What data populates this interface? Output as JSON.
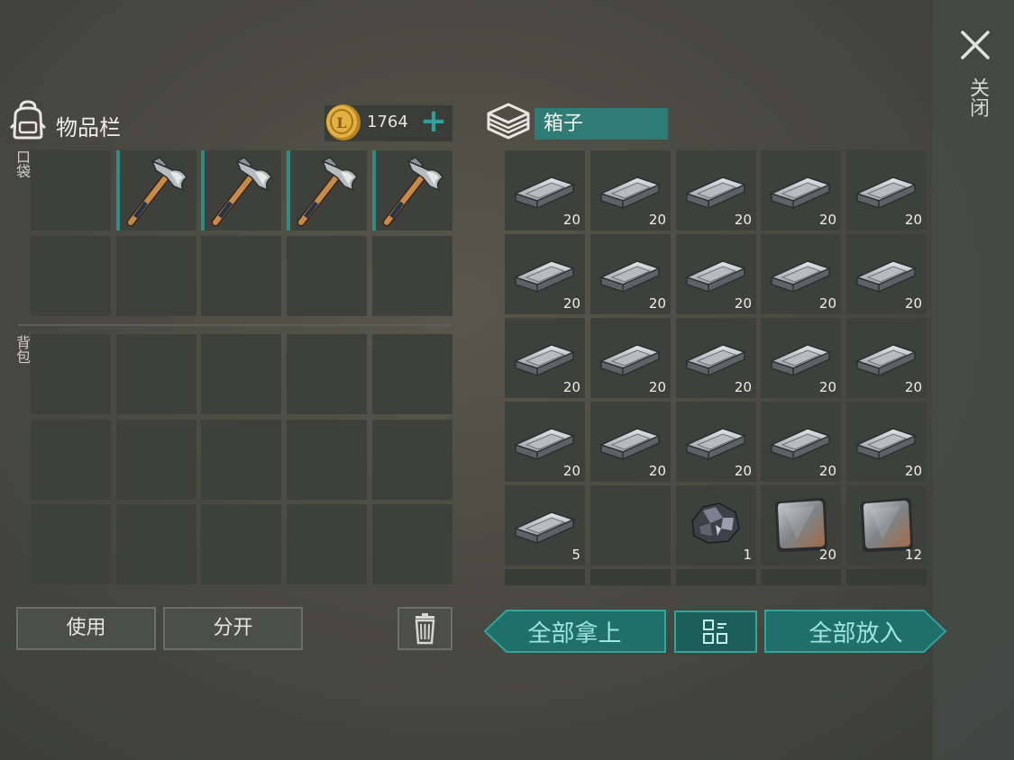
{
  "header": {
    "close_label": "关闭",
    "close_icon": "close-icon"
  },
  "inventory": {
    "title": "物品栏",
    "icon": "backpack-icon",
    "coins": "1764",
    "pocket_label": "口袋",
    "backpack_label": "背包",
    "pocket_slots": [
      {
        "item": "",
        "count": ""
      },
      {
        "item": "hatchet",
        "count": ""
      },
      {
        "item": "hatchet",
        "count": ""
      },
      {
        "item": "hatchet",
        "count": ""
      },
      {
        "item": "hatchet",
        "count": ""
      },
      {
        "item": "",
        "count": ""
      },
      {
        "item": "",
        "count": ""
      },
      {
        "item": "",
        "count": ""
      },
      {
        "item": "",
        "count": ""
      },
      {
        "item": "",
        "count": ""
      }
    ],
    "buttons": {
      "use": "使用",
      "split": "分开",
      "trash_icon": "trash-icon"
    }
  },
  "chest": {
    "title": "箱子",
    "icon": "chest-icon",
    "slots": [
      {
        "item": "iron-ingot",
        "count": "20"
      },
      {
        "item": "iron-ingot",
        "count": "20"
      },
      {
        "item": "iron-ingot",
        "count": "20"
      },
      {
        "item": "iron-ingot",
        "count": "20"
      },
      {
        "item": "iron-ingot",
        "count": "20"
      },
      {
        "item": "iron-ingot",
        "count": "20"
      },
      {
        "item": "iron-ingot",
        "count": "20"
      },
      {
        "item": "iron-ingot",
        "count": "20"
      },
      {
        "item": "iron-ingot",
        "count": "20"
      },
      {
        "item": "iron-ingot",
        "count": "20"
      },
      {
        "item": "iron-ingot",
        "count": "20"
      },
      {
        "item": "iron-ingot",
        "count": "20"
      },
      {
        "item": "iron-ingot",
        "count": "20"
      },
      {
        "item": "iron-ingot",
        "count": "20"
      },
      {
        "item": "iron-ingot",
        "count": "20"
      },
      {
        "item": "iron-ingot",
        "count": "20"
      },
      {
        "item": "iron-ingot",
        "count": "20"
      },
      {
        "item": "iron-ingot",
        "count": "20"
      },
      {
        "item": "iron-ingot",
        "count": "20"
      },
      {
        "item": "iron-ingot",
        "count": "20"
      },
      {
        "item": "iron-ingot",
        "count": "5"
      },
      {
        "item": "",
        "count": ""
      },
      {
        "item": "iron-ore",
        "count": "1"
      },
      {
        "item": "iron-plate",
        "count": "20"
      },
      {
        "item": "iron-plate",
        "count": "12"
      }
    ],
    "buttons": {
      "take_all": "全部拿上",
      "sort_icon": "grid-sort-icon",
      "put_all": "全部放入"
    }
  },
  "colors": {
    "accent": "#29a39b",
    "slot": "#3e403c",
    "background": "#4a4a42"
  }
}
